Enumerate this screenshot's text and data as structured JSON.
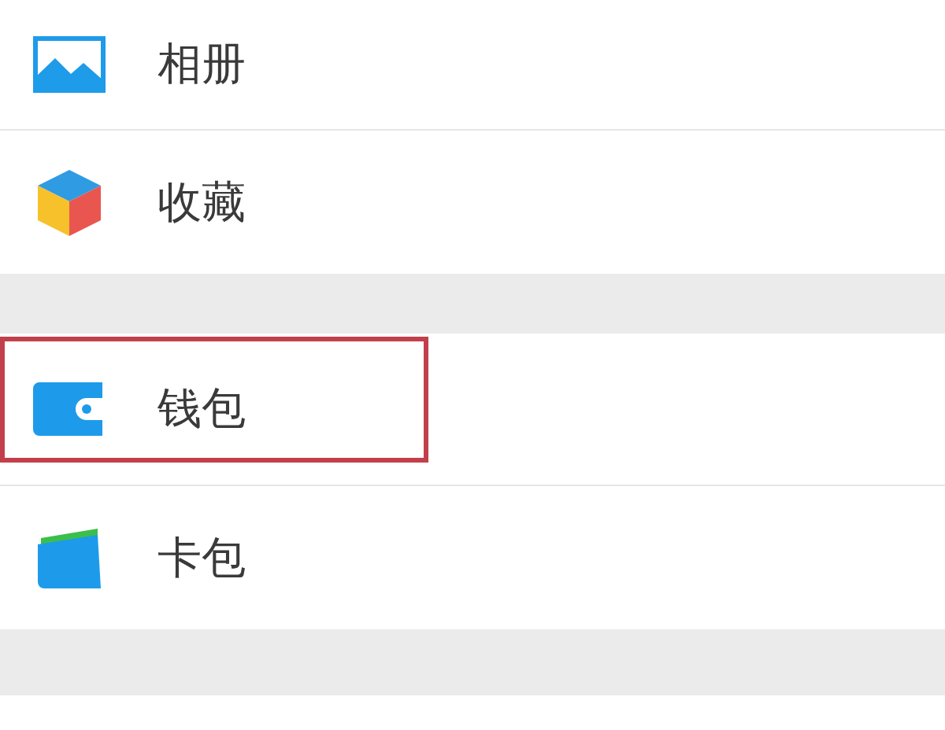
{
  "sections": [
    {
      "items": [
        {
          "kind": "photos",
          "label": "相册",
          "highlighted": false
        },
        {
          "kind": "favorites",
          "label": "收藏",
          "highlighted": false
        }
      ]
    },
    {
      "items": [
        {
          "kind": "wallet",
          "label": "钱包",
          "highlighted": true
        },
        {
          "kind": "cards",
          "label": "卡包",
          "highlighted": false
        }
      ]
    }
  ]
}
